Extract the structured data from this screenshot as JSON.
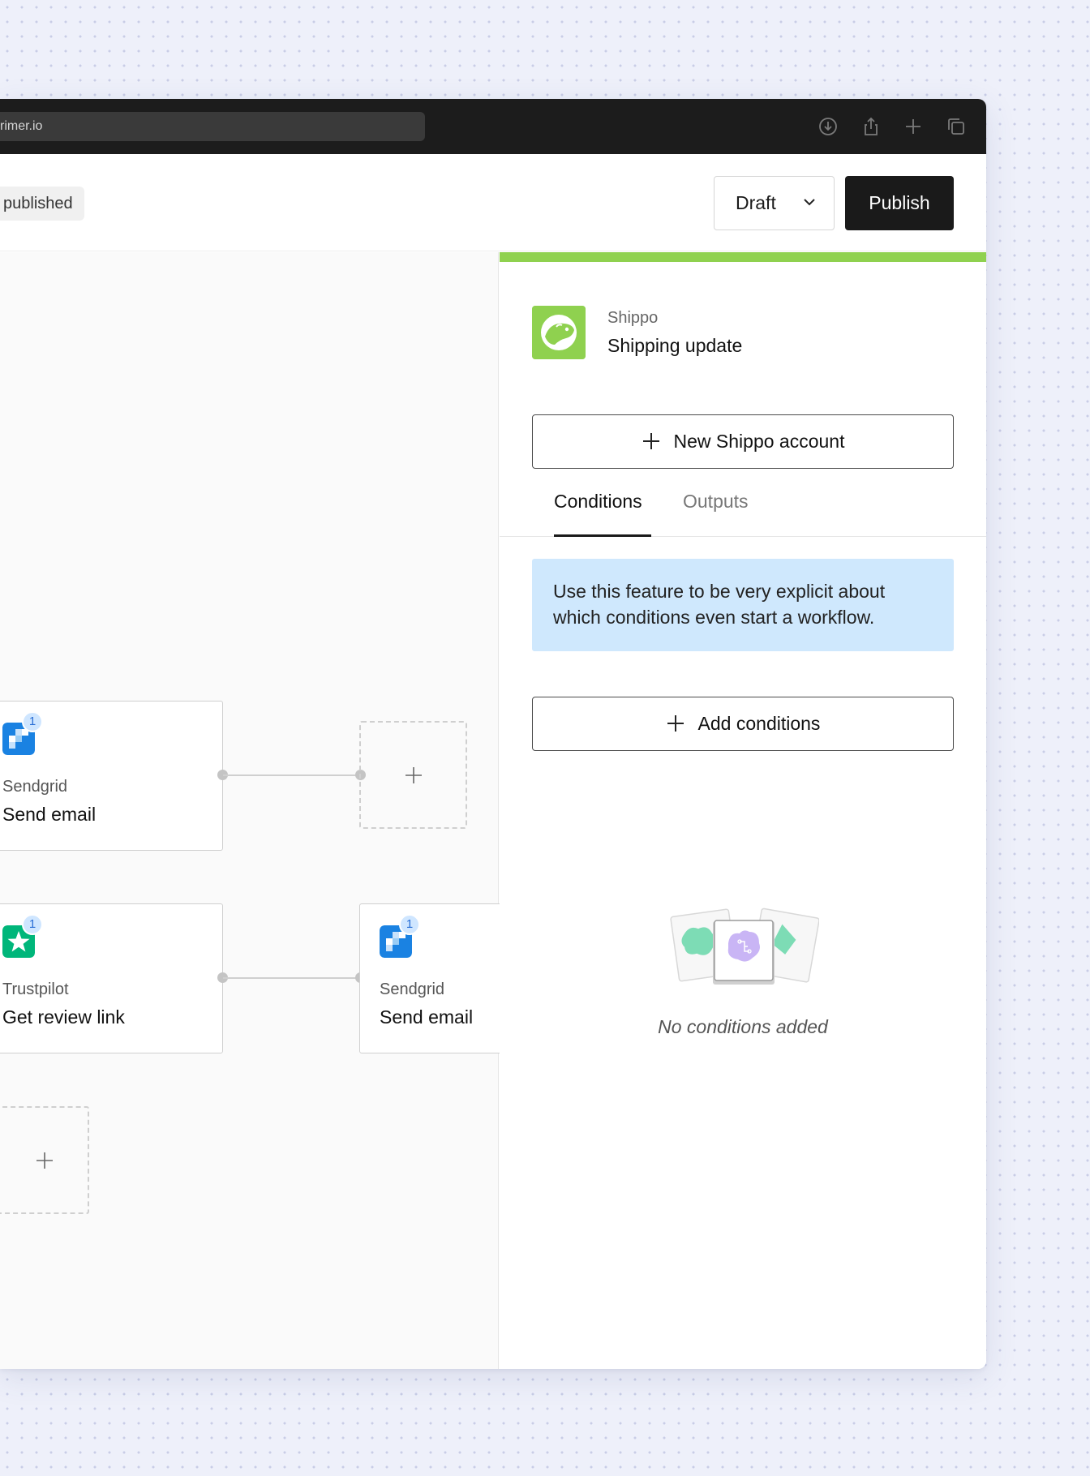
{
  "browser": {
    "url": "rimer.io",
    "icons": [
      "download-icon",
      "share-icon",
      "plus-icon",
      "copy-icon"
    ]
  },
  "header": {
    "status": "published",
    "version_select": "Draft",
    "publish_label": "Publish"
  },
  "canvas": {
    "nodes": [
      {
        "app": "Sendgrid",
        "action": "Send email",
        "badge": "1"
      },
      {
        "app": "Trustpilot",
        "action": "Get review link",
        "badge": "1"
      },
      {
        "app": "Sendgrid",
        "action": "Send email",
        "badge": "1"
      }
    ]
  },
  "panel": {
    "app": "Shippo",
    "action": "Shipping update",
    "new_account_label": "New Shippo account",
    "tabs": [
      {
        "label": "Conditions",
        "active": true
      },
      {
        "label": "Outputs",
        "active": false
      }
    ],
    "info_text": "Use this feature to be very explicit about which conditions even start a workflow.",
    "add_conditions_label": "Add conditions",
    "empty_text": "No conditions added"
  },
  "colors": {
    "accent_green": "#8fd14f",
    "info_blue": "#cfe8fd",
    "sendgrid_blue": "#1a82e2",
    "trustpilot_green": "#00b67a",
    "badge_blue": "#cfe6ff"
  }
}
